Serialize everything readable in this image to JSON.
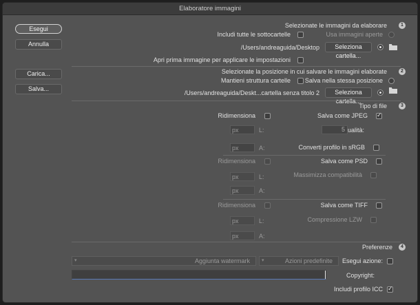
{
  "window": {
    "title": "Elaboratore immagini"
  },
  "buttons": {
    "run": "Esegui",
    "cancel": "Annulla",
    "load": "Carica...",
    "save": "Salva..."
  },
  "section1": {
    "number": "1",
    "title": "Selezionate le immagini da elaborare",
    "use_open": "Usa immagini aperte",
    "include_subfolders": "Includi tutte le sottocartelle",
    "select_folder": "Seleziona cartella...",
    "path": "/Users/andreaguida/Desktop",
    "open_first": "Apri prima immagine per applicare le impostazioni"
  },
  "section2": {
    "number": "2",
    "title": "Selezionate la posizione in cui salvare le immagini elaborate",
    "same_position": "Salva nella stessa posizione",
    "keep_structure": "Mantieni struttura cartelle",
    "select_folder": "Seleziona cartella...",
    "path": "/Users/andreaguida/Deskt...cartella senza titolo 2"
  },
  "section3": {
    "number": "3",
    "title": "Tipo di file",
    "jpeg": {
      "save_label": "Salva come JPEG",
      "resize_label": "Ridimensiona",
      "quality_label": "Qualità:",
      "quality_value": "5",
      "w_label": "L:",
      "h_label": "A:",
      "unit": "px",
      "srgb_label": "Converti profilo in sRGB"
    },
    "psd": {
      "save_label": "Salva come PSD",
      "resize_label": "Ridimensiona",
      "maximize_label": "Massimizza compatibilità",
      "w_label": "L:",
      "h_label": "A:",
      "unit": "px"
    },
    "tiff": {
      "save_label": "Salva come TIFF",
      "resize_label": "Ridimensiona",
      "lzw_label": "Compressione LZW",
      "w_label": "L:",
      "h_label": "A:",
      "unit": "px"
    }
  },
  "section4": {
    "number": "4",
    "title": "Preferenze",
    "run_action_label": "Esegui azione:",
    "action_set": "Azioni predefinite",
    "action": "Aggiunta watermark",
    "copyright_label": "Copyright:",
    "copyright_value": "",
    "icc_label": "Includi profilo ICC"
  }
}
